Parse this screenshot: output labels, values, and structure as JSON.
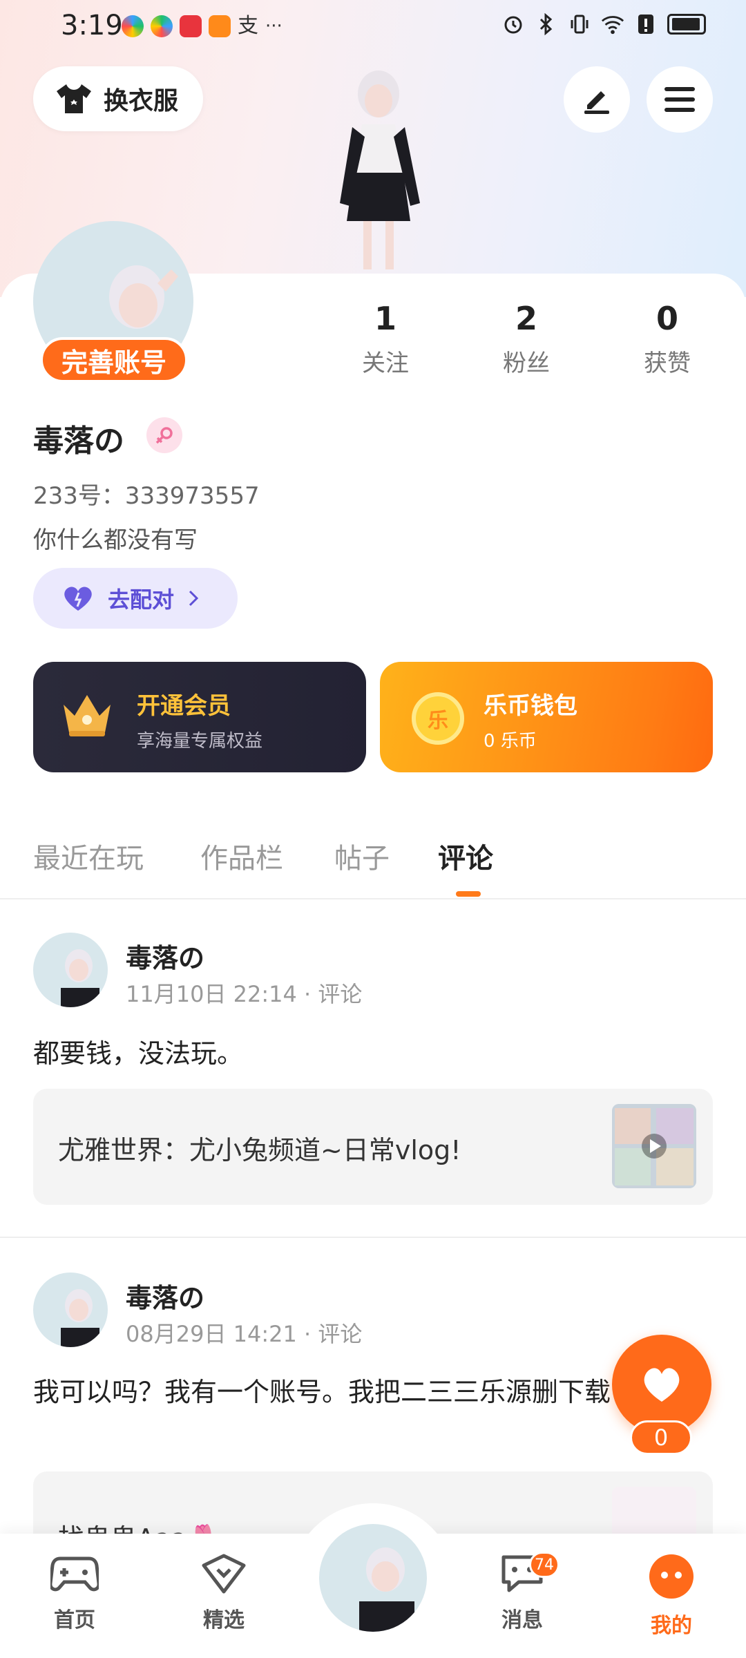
{
  "status_bar": {
    "time": "3:19",
    "app_icons": [
      {
        "name": "color-wheel-app-icon",
        "color": "#3aa0ff"
      },
      {
        "name": "color-wheel-app-icon-2",
        "color": "#20c06a"
      },
      {
        "name": "red-book-app-icon",
        "color": "#e8343d"
      },
      {
        "name": "video-app-icon",
        "color": "#ff8a1a"
      }
    ],
    "alipay_glyph": "支",
    "more_glyph": "···"
  },
  "header": {
    "outfit_button_label": "换衣服",
    "edit_icon": "pen-icon",
    "menu_icon": "hamburger-icon"
  },
  "profile": {
    "complete_account_label": "完善账号",
    "username": "毒落の",
    "gender_icon": "female-icon",
    "uid": "233号：333973557",
    "bio": "你什么都没有写",
    "match_button_label": "去配对",
    "stats": [
      {
        "value": "1",
        "label": "关注"
      },
      {
        "value": "2",
        "label": "粉丝"
      },
      {
        "value": "0",
        "label": "获赞"
      }
    ]
  },
  "cards": {
    "vip": {
      "title": "开通会员",
      "subtitle": "享海量专属权益",
      "title_color": "#ffc23a",
      "subtitle_color": "#bfbcc9"
    },
    "wallet": {
      "title": "乐币钱包",
      "subtitle": "0 乐币",
      "coin_glyph": "乐"
    }
  },
  "tabs": [
    {
      "label": "最近在玩",
      "active": false
    },
    {
      "label": "作品栏",
      "active": false
    },
    {
      "label": "帖子",
      "active": false
    },
    {
      "label": "评论",
      "active": true
    }
  ],
  "posts": [
    {
      "author": "毒落の",
      "meta": "11月10日 22:14 · 评论",
      "text": "都要钱，没法玩。",
      "quote": "尤雅世界：尤小兔频道~日常vlog!"
    },
    {
      "author": "毒落の",
      "meta": "08月29日 14:21 · 评论",
      "text": "我可以吗？我有一个账号。我把二三三乐源删下载",
      "quote": "找鬼鬼Aaa🌷"
    }
  ],
  "like_fab": {
    "count": "0"
  },
  "bottom_nav": {
    "items": [
      {
        "label": "首页",
        "icon": "gamepad-icon",
        "active": false
      },
      {
        "label": "精选",
        "icon": "heart-shield-icon",
        "active": false
      },
      {
        "label": "消息",
        "icon": "chat-bubble-icon",
        "active": false,
        "badge": "74"
      },
      {
        "label": "我的",
        "icon": "profile-face-icon",
        "active": true
      }
    ]
  },
  "colors": {
    "accent": "#ff6a1a",
    "match_purple": "#5d4fd6",
    "vip_dark": "#2b2a3a"
  }
}
